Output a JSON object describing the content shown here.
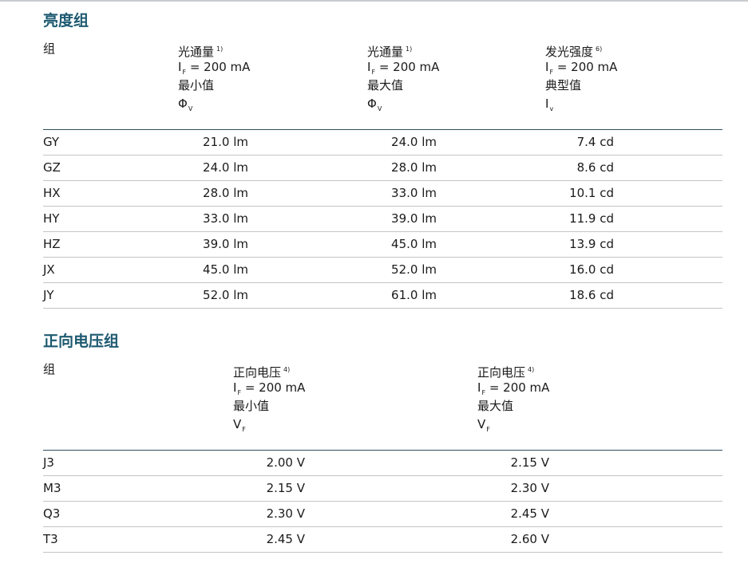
{
  "brightness": {
    "title": "亮度组",
    "headers": {
      "group": "组",
      "col1": {
        "name": "光通量",
        "note": "1)",
        "condition_I": "I",
        "condition_sub": "F",
        "condition_rest": " = 200 mA",
        "stat": "最小值",
        "symbol": "Φ",
        "symbol_sub": "V"
      },
      "col2": {
        "name": "光通量",
        "note": "1)",
        "condition_I": "I",
        "condition_sub": "F",
        "condition_rest": " = 200 mA",
        "stat": "最大值",
        "symbol": "Φ",
        "symbol_sub": "V"
      },
      "col3": {
        "name": "发光强度",
        "note": "6)",
        "condition_I": "I",
        "condition_sub": "F",
        "condition_rest": " = 200 mA",
        "stat": "典型值",
        "symbol": "I",
        "symbol_sub": "v"
      }
    },
    "rows": [
      {
        "group": "GY",
        "min": "21.0 lm",
        "max": "24.0 lm",
        "typ": "7.4 cd"
      },
      {
        "group": "GZ",
        "min": "24.0 lm",
        "max": "28.0 lm",
        "typ": "8.6 cd"
      },
      {
        "group": "HX",
        "min": "28.0 lm",
        "max": "33.0 lm",
        "typ": "10.1 cd"
      },
      {
        "group": "HY",
        "min": "33.0 lm",
        "max": "39.0 lm",
        "typ": "11.9 cd"
      },
      {
        "group": "HZ",
        "min": "39.0 lm",
        "max": "45.0 lm",
        "typ": "13.9 cd"
      },
      {
        "group": "JX",
        "min": "45.0 lm",
        "max": "52.0 lm",
        "typ": "16.0 cd"
      },
      {
        "group": "JY",
        "min": "52.0 lm",
        "max": "61.0 lm",
        "typ": "18.6 cd"
      }
    ]
  },
  "voltage": {
    "title": "正向电压组",
    "headers": {
      "group": "组",
      "col1": {
        "name": "正向电压",
        "note": "4)",
        "condition_I": "I",
        "condition_sub": "F",
        "condition_rest": " = 200 mA",
        "stat": "最小值",
        "symbol": "V",
        "symbol_sub": "F"
      },
      "col2": {
        "name": "正向电压",
        "note": "4)",
        "condition_I": "I",
        "condition_sub": "F",
        "condition_rest": " = 200 mA",
        "stat": "最大值",
        "symbol": "V",
        "symbol_sub": "F"
      }
    },
    "rows": [
      {
        "group": "J3",
        "min": "2.00 V",
        "max": "2.15 V"
      },
      {
        "group": "M3",
        "min": "2.15 V",
        "max": "2.30 V"
      },
      {
        "group": "Q3",
        "min": "2.30 V",
        "max": "2.45 V"
      },
      {
        "group": "T3",
        "min": "2.45 V",
        "max": "2.60 V"
      }
    ]
  }
}
